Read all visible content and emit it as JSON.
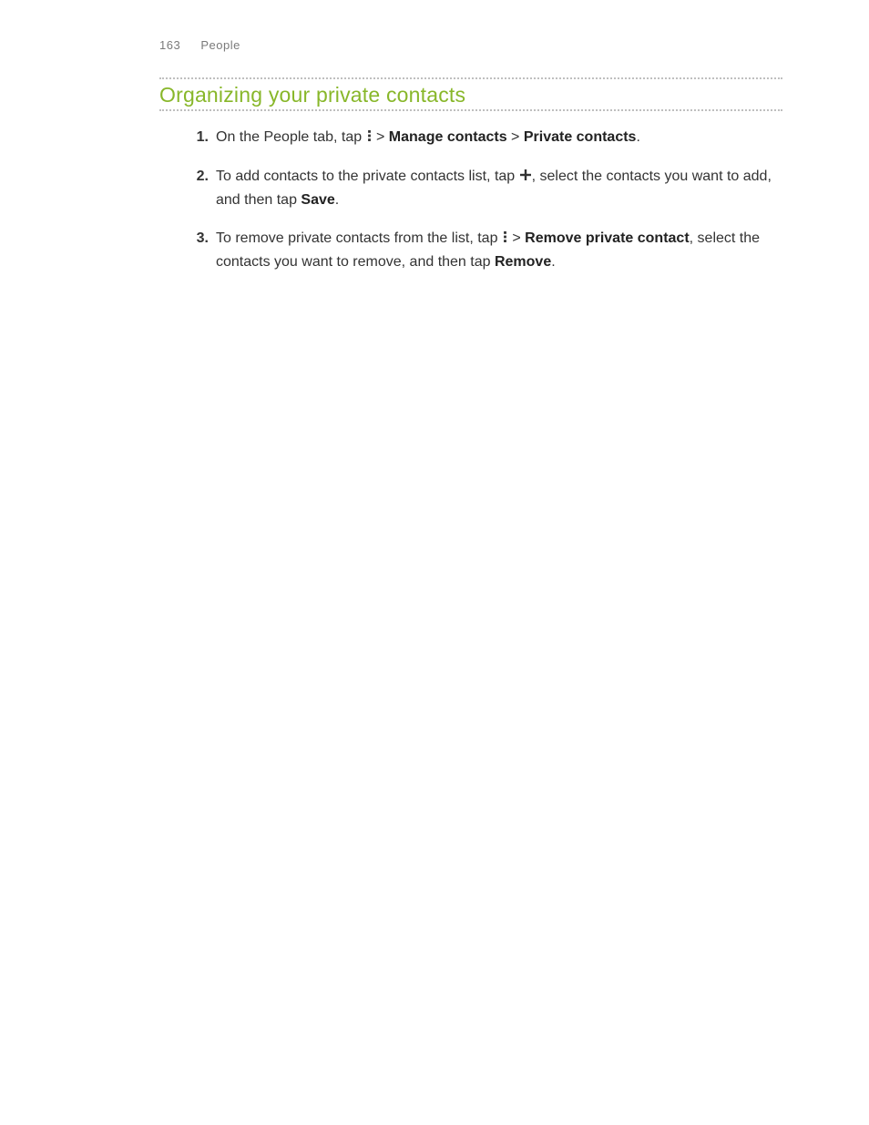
{
  "header": {
    "page_number": "163",
    "chapter": "People"
  },
  "section": {
    "title": "Organizing your private contacts"
  },
  "steps": {
    "s1": {
      "t1": "On the People tab, tap ",
      "t2": " > ",
      "b1": "Manage contacts",
      "t3": " > ",
      "b2": "Private contacts",
      "t4": "."
    },
    "s2": {
      "t1": "To add contacts to the private contacts list, tap ",
      "t2": ", select the contacts you want to add, and then tap ",
      "b1": "Save",
      "t3": "."
    },
    "s3": {
      "t1": "To remove private contacts from the list, tap ",
      "t2": " > ",
      "b1": "Remove private contact",
      "t3": ", select the contacts you want to remove, and then tap ",
      "b2": "Remove",
      "t4": "."
    }
  }
}
